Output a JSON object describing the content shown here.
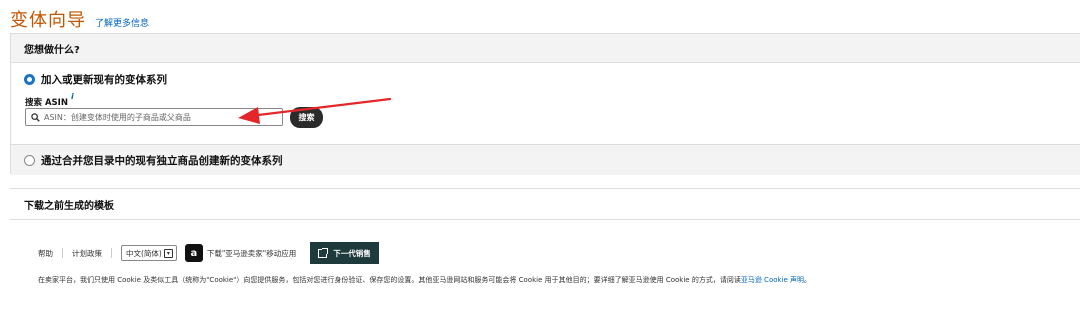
{
  "header": {
    "title": "变体向导",
    "learn_more": "了解更多信息"
  },
  "main": {
    "question": "您想做什么?",
    "option1_label": "加入或更新现有的变体系列",
    "option1_selected": true,
    "search_label": "搜索 ASIN",
    "info_icon_glyph": "i",
    "search_placeholder": "ASIN：创建变体时使用的子商品或父商品",
    "search_button": "搜索",
    "option2_label": "通过合并您目录中的现有独立商品创建新的变体系列",
    "option2_selected": false
  },
  "templates": {
    "label": "下载之前生成的模板"
  },
  "footer": {
    "help": "帮助",
    "policies": "计划政策",
    "language": "中文(简体)",
    "app_icon_glyph": "a",
    "app_link": "下载\"亚马逊卖家\"移动应用",
    "next_gen": "下一代销售"
  },
  "cookie": {
    "text": "在卖家平台，我们只使用 Cookie 及类似工具（统称为\"Cookie\"）向您提供服务，包括对您进行身份验证、保存您的设置。其他亚马逊网站和服务可能会将 Cookie 用于其他目的；要详细了解亚马逊使用 Cookie 的方式，请阅读",
    "link": "亚马逊 Cookie 声明",
    "end": "。"
  },
  "colors": {
    "title": "#c45500",
    "link": "#0066c0",
    "radio_selected": "#1a73c8",
    "annotation_arrow": "#e3262a",
    "next_button": "#1f3a3d"
  }
}
